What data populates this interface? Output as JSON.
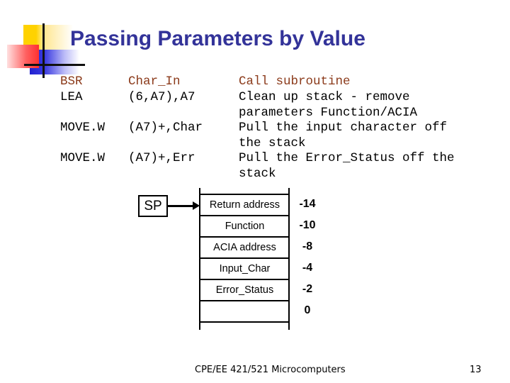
{
  "slide": {
    "title": "Passing Parameters by Value",
    "code_lines": [
      {
        "op": "BSR",
        "operand": "Char_In",
        "comment": "Call subroutine",
        "highlight": true
      },
      {
        "op": "LEA",
        "operand": "(6,A7),A7",
        "comment": "Clean up stack - remove\nparameters Function/ACIA",
        "highlight": false
      },
      {
        "op": "MOVE.W",
        "operand": "(A7)+,Char",
        "comment": "Pull the input character off\nthe stack",
        "highlight": false
      },
      {
        "op": "MOVE.W",
        "operand": "(A7)+,Err",
        "comment": "Pull the Error_Status off the\nstack",
        "highlight": false
      }
    ],
    "stack_diagram": {
      "pointer_label": "SP",
      "cells": [
        {
          "label": "Return address",
          "offset": "-14"
        },
        {
          "label": "Function",
          "offset": "-10"
        },
        {
          "label": "ACIA address",
          "offset": "-8"
        },
        {
          "label": "Input_Char",
          "offset": "-4"
        },
        {
          "label": "Error_Status",
          "offset": "-2"
        },
        {
          "label": "",
          "offset": "0"
        }
      ]
    },
    "footer": {
      "course": "CPE/EE 421/521 Microcomputers",
      "page_number": "13"
    },
    "colors": {
      "title": "#333399",
      "highlight_code": "#8b3a1a"
    }
  }
}
